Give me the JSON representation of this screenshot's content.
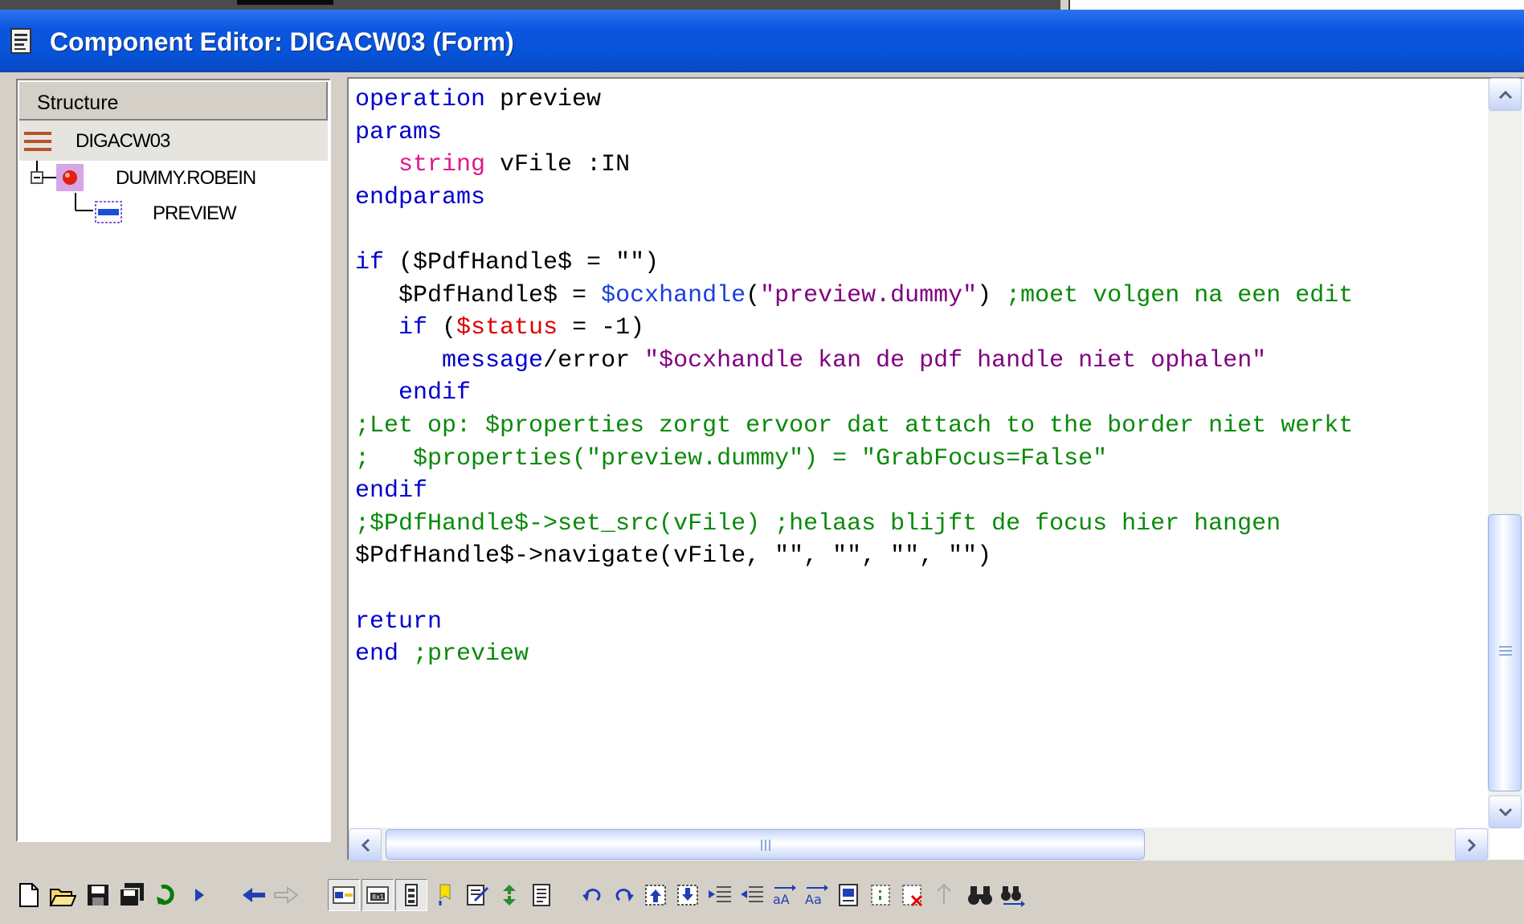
{
  "window": {
    "title": "Component Editor: DIGACW03 (Form)"
  },
  "tree": {
    "header": "Structure",
    "nodes": [
      {
        "label": "DIGACW03",
        "icon": "form-icon"
      },
      {
        "label": "DUMMY.ROBEIN",
        "icon": "entity-icon"
      },
      {
        "label": "PREVIEW",
        "icon": "field-icon"
      }
    ]
  },
  "editor": {
    "operation": "operation",
    "op_name": " preview",
    "params": "params",
    "string": "string",
    "param_decl": " vFile :IN",
    "endparams": "endparams",
    "if1": "if",
    "if1_cond": " ($PdfHandle$ = \"\")",
    "assign_lhs": "$PdfHandle$ = ",
    "ocxhandle": "$ocxhandle",
    "ocx_open": "(",
    "ocx_arg": "\"preview.dummy\"",
    "ocx_close": ")",
    "ocx_comment": " ;moet volgen na een edit",
    "if2": "if",
    "if2_open": " (",
    "status": "$status",
    "if2_rest": " = -1)",
    "message": "message",
    "msg_error": "/error ",
    "msg_text": "\"$ocxhandle kan de pdf handle niet ophalen\"",
    "endif_inner": "endif",
    "comment1": ";Let op: $properties zorgt ervoor dat attach to the border niet werkt",
    "comment2_a": ";   $properties(\"preview.dummy\") = ",
    "comment2_b": "\"GrabFocus=False\"",
    "endif_outer": "endif",
    "comment3": ";$PdfHandle$->set_src(vFile) ;helaas blijft de focus hier hangen",
    "navigate": "$PdfHandle$->navigate(vFile, \"\", \"\", \"\", \"\")",
    "return_kw": "return",
    "end_kw": "end",
    "end_comment": " ;preview"
  },
  "toolbar": {
    "buttons": [
      "new-icon",
      "open-icon",
      "save-icon",
      "save-all-icon",
      "compile-icon",
      "run-icon",
      "back-icon",
      "forward-icon",
      "view-structure-icon",
      "view-8x1-icon",
      "view-list-icon",
      "bookmark-icon",
      "check-icon",
      "refresh-icon",
      "document-icon",
      "undo-icon",
      "redo-icon",
      "indent-icon",
      "outdent-icon",
      "increase-indent-icon",
      "decrease-indent-icon",
      "uppercase-icon",
      "lowercase-icon",
      "page-icon",
      "comment-icon",
      "uncomment-icon",
      "paste-icon",
      "find-icon",
      "find-next-icon"
    ]
  }
}
